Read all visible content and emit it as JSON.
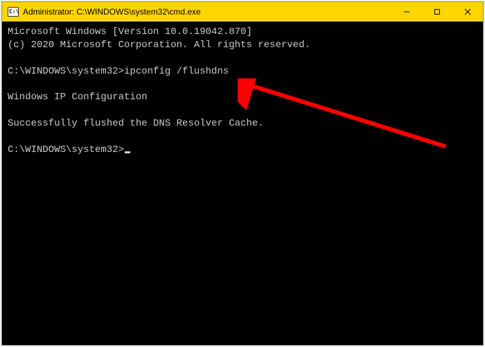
{
  "window": {
    "title": "Administrator: C:\\WINDOWS\\system32\\cmd.exe",
    "icon_label": "C:\\"
  },
  "terminal": {
    "line1": "Microsoft Windows [Version 10.0.19042.870]",
    "line2": "(c) 2020 Microsoft Corporation. All rights reserved.",
    "blank1": "",
    "prompt1_path": "C:\\WINDOWS\\system32>",
    "prompt1_cmd": "ipconfig /flushdns",
    "blank2": "",
    "line3": "Windows IP Configuration",
    "blank3": "",
    "line4": "Successfully flushed the DNS Resolver Cache.",
    "blank4": "",
    "prompt2_path": "C:\\WINDOWS\\system32>"
  },
  "annotation": {
    "arrow_color": "#ff0000"
  }
}
